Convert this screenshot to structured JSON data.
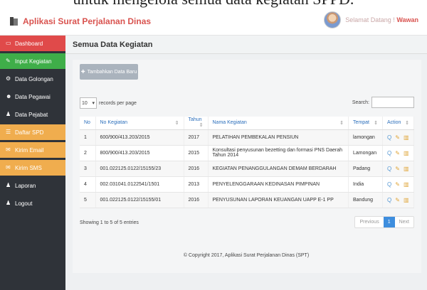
{
  "caption": "untuk mengelola semua data kegiatan SPPD.",
  "header": {
    "app_title": "Aplikasi Surat Perjalanan Dinas",
    "greeting": "Selamat Datang !",
    "username": "Wawan"
  },
  "sidebar": {
    "items": [
      {
        "label": "Dashboard",
        "color": "#e04a4a",
        "icon": "monitor-icon",
        "glyph": "▭"
      },
      {
        "label": "Input Kegiatan",
        "color": "#3fae49",
        "icon": "pencil-icon",
        "glyph": "✎"
      },
      {
        "label": "Data Golongan",
        "color": "#2f3339",
        "icon": "gear-icon",
        "glyph": "⚙"
      },
      {
        "label": "Data Pegawai",
        "color": "#2f3339",
        "icon": "users-icon",
        "glyph": "☻"
      },
      {
        "label": "Data Pejabat",
        "color": "#2f3339",
        "icon": "user-icon",
        "glyph": "♟"
      },
      {
        "label": "Daftar SPD",
        "color": "#f0ad4e",
        "icon": "list-icon",
        "glyph": "☰"
      },
      {
        "label": "Kirim Email",
        "color": "#f0ad4e",
        "icon": "email-icon",
        "glyph": "✉"
      },
      {
        "label": "Kirim SMS",
        "color": "#f0ad4e",
        "icon": "sms-icon",
        "glyph": "✉"
      },
      {
        "label": "Laporan",
        "color": "#2f3339",
        "icon": "report-icon",
        "glyph": "♟"
      },
      {
        "label": "Logout",
        "color": "#2f3339",
        "icon": "logout-icon",
        "glyph": "♟"
      }
    ]
  },
  "page": {
    "title": "Semua Data Kegiatan",
    "add_button": "Tambahkan Data Baru",
    "per_page_value": "10",
    "per_page_label": "records per page",
    "search_label": "Search:",
    "search_value": "",
    "showing": "Showing 1 to 5 of 5 entries",
    "pager": {
      "previous": "Previous",
      "current": "1",
      "next": "Next"
    },
    "footer": "© Copyright 2017, Aplikasi Surat Perjalanan Dinas (SPT)"
  },
  "table": {
    "headers": [
      "No",
      "No Kegiatan",
      "Tahun",
      "Nama Kegiatan",
      "Tempat",
      "Action"
    ],
    "rows": [
      [
        "1",
        "600/900/413.203/2015",
        "2017",
        "PELATIHAN PEMBEKALAN PENSIUN",
        "lamongan"
      ],
      [
        "2",
        "800/900/413.203/2015",
        "2015",
        "Konsultasi penyusunan bezetting dan formasi PNS Daerah Tahun 2014",
        "Lamongan"
      ],
      [
        "3",
        "001.022125.0122/15155/23",
        "2016",
        "KEGIATAN PENANGGULANGAN DEMAM BERDARAH",
        "Padang"
      ],
      [
        "4",
        "002.031041.0122541/1501",
        "2013",
        "PENYELENGGARAAN KEDINASAN PIMPINAN",
        "India"
      ],
      [
        "5",
        "001.022125.0122/15155/01",
        "2016",
        "PENYUSUNAN LAPORAN KEUANGAN UAPP E-1 PP",
        "Bandung"
      ]
    ]
  }
}
